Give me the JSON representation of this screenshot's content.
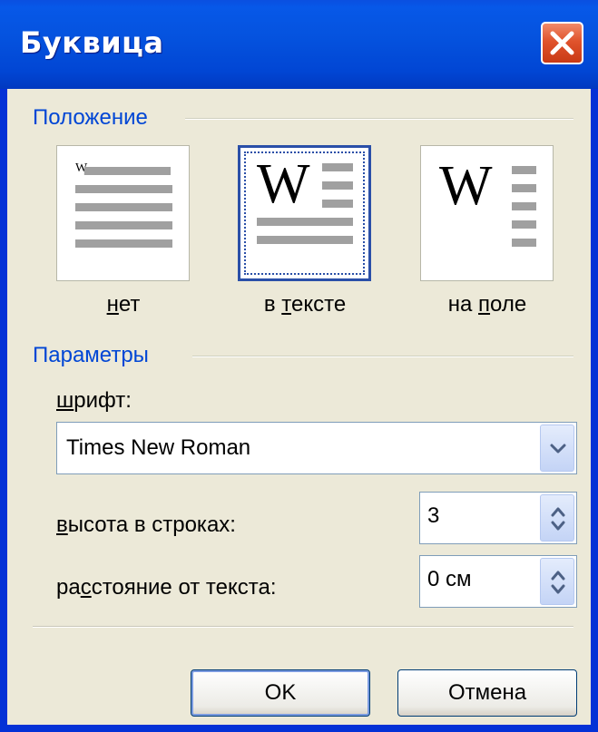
{
  "window": {
    "title": "Буквица",
    "close_icon": "close-icon"
  },
  "position_group": {
    "label": "Положение",
    "options": [
      {
        "id": "none",
        "label_pre": "",
        "label_underlined": "н",
        "label_post": "ет",
        "selected": false,
        "preview_letter": "W"
      },
      {
        "id": "in-text",
        "label_pre": "в ",
        "label_underlined": "т",
        "label_post": "ексте",
        "selected": true,
        "preview_letter": "W"
      },
      {
        "id": "margin",
        "label_pre": "на ",
        "label_underlined": "п",
        "label_post": "оле",
        "selected": false,
        "preview_letter": "W"
      }
    ]
  },
  "params_group": {
    "label": "Параметры",
    "font_label_underlined": "ш",
    "font_label_rest": "рифт:",
    "font_value": "Times New Roman",
    "height_label_underlined": "в",
    "height_label_rest": "ысота в строках:",
    "height_value": "3",
    "distance_label_pre": "ра",
    "distance_label_underlined": "с",
    "distance_label_post": "стояние от текста:",
    "distance_value": "0 см"
  },
  "buttons": {
    "ok": "OK",
    "cancel": "Отмена"
  },
  "colors": {
    "title_bar": "#0553df",
    "group_label": "#0046d5",
    "dialog_bg": "#ece9d8",
    "close_button": "#e0532c"
  }
}
